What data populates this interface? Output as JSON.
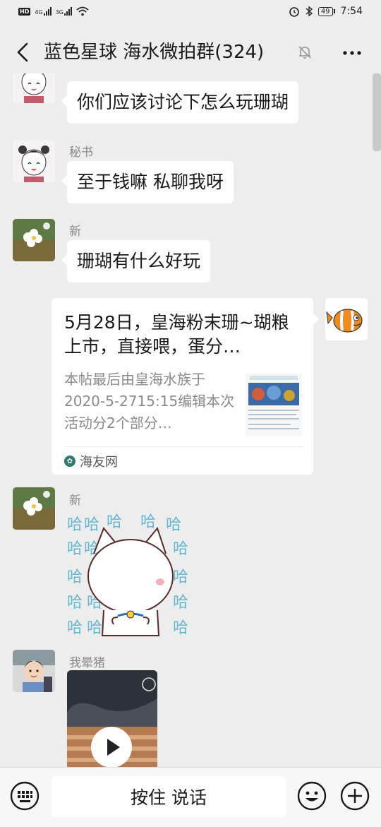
{
  "status_bar": {
    "left_tag": "HD",
    "sig1_label": "4G",
    "sig2_label": "3G",
    "battery": "49",
    "time": "7:54"
  },
  "header": {
    "title": "蓝色星球 海水微拍群(324)"
  },
  "messages": {
    "m1": {
      "text": "你们应该讨论下怎么玩珊瑚"
    },
    "m2": {
      "sender": "秘书",
      "text": "至于钱嘛 私聊我呀"
    },
    "m3": {
      "sender": "新",
      "text": "珊瑚有什么好玩"
    },
    "m4": {
      "card_title": "5月28日，皇海粉末珊~瑚粮上市，直接喂，蛋分…",
      "card_desc": "本帖最后由皇海水族于2020-5-2715:15编辑本次活动分2个部分…",
      "card_source": "海友网"
    },
    "m5": {
      "sender": "新",
      "sticker_text": "哈"
    },
    "m6": {
      "sender": "我晕猪"
    }
  },
  "input_bar": {
    "hold_label": "按住 说话"
  },
  "colors": {
    "background": "#ededed",
    "bubble": "#ffffff",
    "sender_text": "#8a8a8a"
  },
  "icons": [
    "back-arrow-icon",
    "mute-bell-icon",
    "more-icon",
    "voice-keyboard-icon",
    "emoji-icon",
    "plus-icon",
    "play-icon"
  ]
}
